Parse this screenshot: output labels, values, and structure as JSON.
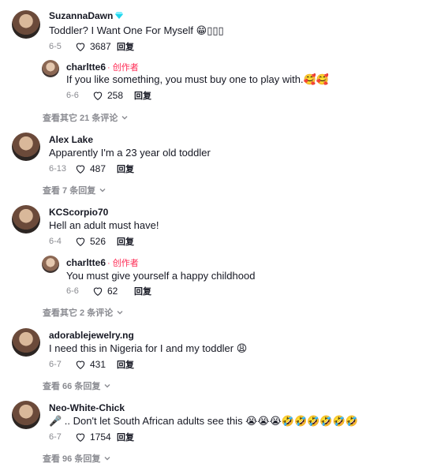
{
  "comments": [
    {
      "user": "SuzannaDawn",
      "text": "Toddler? I Want One For Myself 😁▯▯▯",
      "date": "6-5",
      "likes": "3687",
      "reply": "回复",
      "replies": [
        {
          "user": "charltte6",
          "creator": "· 创作者",
          "text": "If you like something, you must buy one to play with.🥰🥰",
          "date": "6-6",
          "likes": "258",
          "reply": "回复"
        }
      ],
      "more": "查看其它 21 条评论"
    },
    {
      "user": "Alex Lake",
      "text": "Apparently I'm a 23 year old toddler",
      "date": "6-13",
      "likes": "487",
      "reply": "回复",
      "replies": [],
      "more": "查看 7 条回复"
    },
    {
      "user": "KCScorpio70",
      "text": "Hell an adult must have!",
      "date": "6-4",
      "likes": "526",
      "reply": "回复",
      "replies": [
        {
          "user": "charltte6",
          "creator": "· 创作者",
          "text": "You must give yourself a happy childhood",
          "date": "6-6",
          "likes": "62",
          "reply": "回复"
        }
      ],
      "more": "查看其它 2 条评论"
    },
    {
      "user": "adorablejewelry.ng",
      "text": "I need this in Nigeria for I and my toddler 😩",
      "date": "6-7",
      "likes": "431",
      "reply": "回复",
      "replies": [],
      "more": "查看 66 条回复"
    },
    {
      "user": "Neo-White-Chick",
      "text": "🎤 .. Don't let South African adults see this 😭😭😭🤣🤣🤣🤣🤣🤣",
      "date": "6-7",
      "likes": "1754",
      "reply": "回复",
      "replies": [],
      "more": "查看 96 条回复"
    }
  ],
  "icons": {
    "heart": "heart-outline-icon",
    "chevron": "chevron-down-icon",
    "verified": "diamond-badge-icon"
  },
  "colors": {
    "creator": "#fe2c55",
    "muted": "#8a8b91",
    "text": "#161823",
    "badge": "#20d5ec"
  }
}
